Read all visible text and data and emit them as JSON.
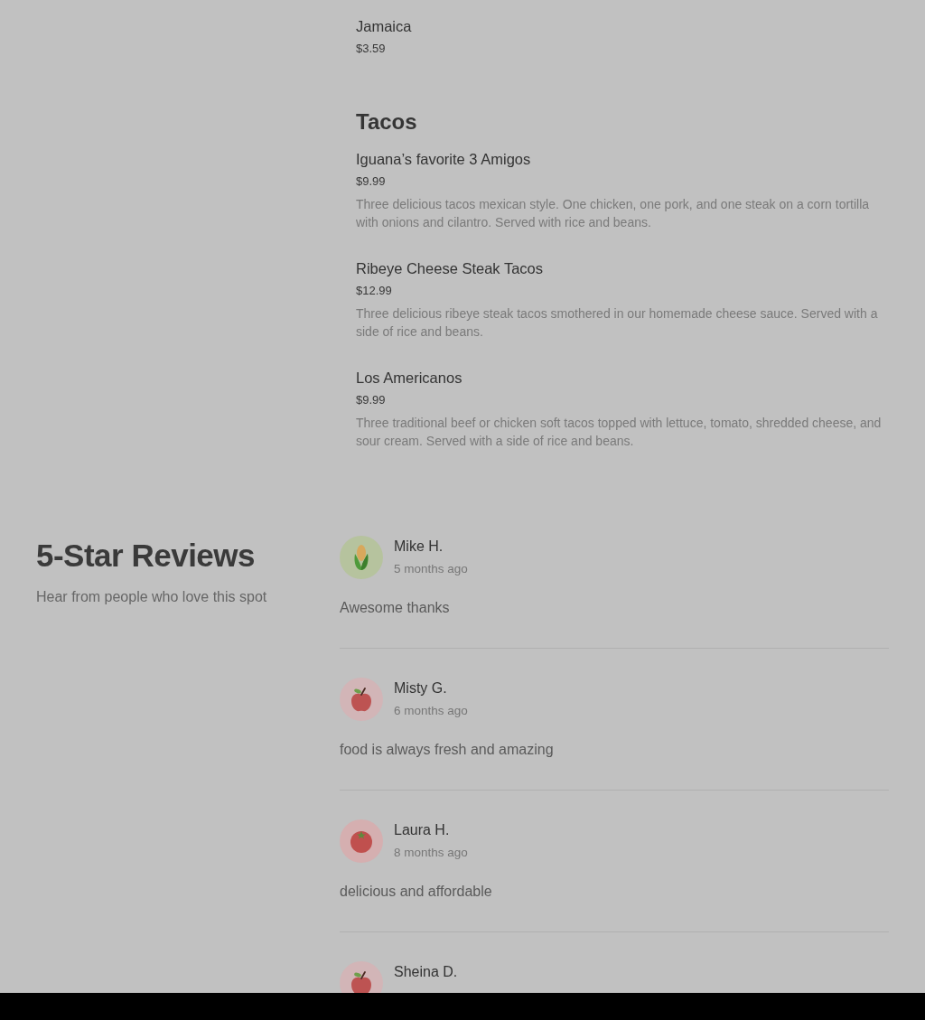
{
  "menu": {
    "categories": [
      {
        "items": [
          {
            "name": "Jamaica",
            "price": "$3.59"
          }
        ]
      },
      {
        "title": "Tacos",
        "items": [
          {
            "name": "Iguana’s favorite 3 Amigos",
            "price": "$9.99",
            "description": "Three delicious tacos mexican style. One chicken, one pork, and one steak on a corn tortilla with onions and cilantro. Served with rice and beans."
          },
          {
            "name": "Ribeye Cheese Steak Tacos",
            "price": "$12.99",
            "description": "Three delicious ribeye steak tacos smothered in our homemade cheese sauce. Served with a side of rice and beans."
          },
          {
            "name": "Los Americanos",
            "price": "$9.99",
            "description": "Three traditional beef or chicken soft tacos topped with lettuce, tomato, shredded cheese, and sour cream. Served with a side of rice and beans."
          }
        ]
      }
    ]
  },
  "reviews": {
    "title": "5-Star Reviews",
    "subtitle": "Hear from people who love this spot",
    "items": [
      {
        "kind": "corn",
        "author": "Mike H.",
        "time": "5 months ago",
        "text": "Awesome thanks"
      },
      {
        "kind": "apple",
        "author": "Misty G.",
        "time": "6 months ago",
        "text": "food is always fresh and amazing"
      },
      {
        "kind": "tomato",
        "author": "Laura H.",
        "time": "8 months ago",
        "text": "delicious and affordable"
      },
      {
        "kind": "apple",
        "author": "Sheina D."
      }
    ]
  }
}
